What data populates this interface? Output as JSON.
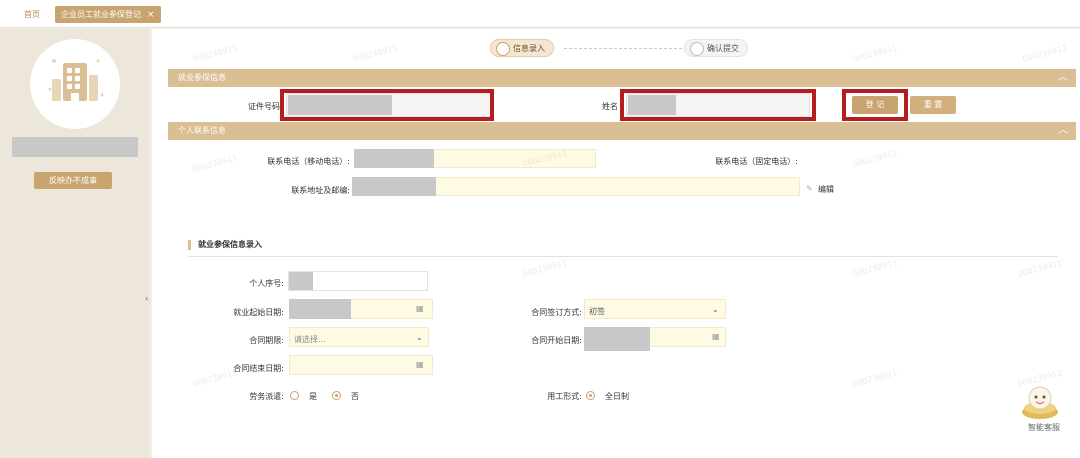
{
  "tabs": {
    "home": "首页",
    "active": "企业员工就业参保登记",
    "close": "×"
  },
  "watermark": "000238911",
  "sidebar": {
    "feedback": "反映办不成事",
    "collapse": "‹"
  },
  "steps": [
    {
      "label": "信息录入"
    },
    {
      "label": "确认提交"
    }
  ],
  "section1": {
    "title": "就业参保信息",
    "caret": "︿",
    "id_label": "证件号码",
    "name_label": "姓名",
    "register_button": "登 记",
    "reset_button": "重 置"
  },
  "section2": {
    "title": "个人联系信息",
    "caret": "︿",
    "mobile_label": "联系电话（移动电话）:",
    "landline_label": "联系电话（固定电话）:",
    "address_label": "联系地址及邮编:",
    "edit_label": "编辑"
  },
  "section3": {
    "title": "就业参保信息录入",
    "serial_label": "个人序号:",
    "start_date_label": "就业起始日期:",
    "contract_sign_label": "合同签订方式:",
    "contract_sign_value": "初签",
    "contract_term_label": "合同期限:",
    "contract_term_placeholder": "请选择...",
    "contract_start_label": "合同开始日期:",
    "contract_end_label": "合同结束日期:",
    "dispatch_label": "劳务派遣:",
    "dispatch_yes": "是",
    "dispatch_no": "否",
    "employment_form_label": "用工形式:",
    "employment_form_value": "全日制"
  },
  "assistant": {
    "label": "智能客服"
  },
  "colors": {
    "gold": "#c9a46e",
    "header": "#d9bf93",
    "highlight": "#b41e1e",
    "field_yellow": "#fffbe3"
  }
}
